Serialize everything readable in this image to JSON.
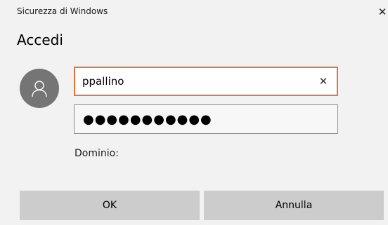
{
  "window": {
    "title": "Sicurezza di Windows",
    "close_glyph": "✕"
  },
  "dialog": {
    "heading": "Accedi",
    "avatar_icon": "user-icon"
  },
  "username": {
    "value": "ppallino",
    "clear_glyph": "✕"
  },
  "password": {
    "masked_value": "●●●●●●●●●●●"
  },
  "domain": {
    "label": "Dominio:"
  },
  "buttons": {
    "ok_label": "OK",
    "cancel_label": "Annulla"
  },
  "colors": {
    "focus_border": "#e3743a",
    "avatar_bg": "#757575",
    "button_bg": "#cccccc",
    "background": "#f2f2f2"
  }
}
